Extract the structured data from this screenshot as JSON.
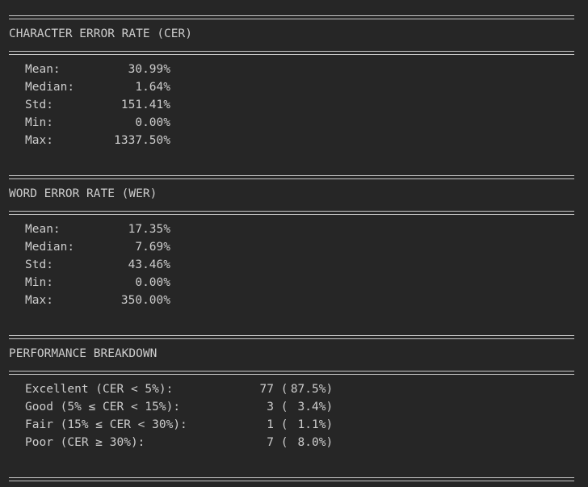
{
  "cer": {
    "title": "CHARACTER ERROR RATE (CER)",
    "stats": [
      {
        "label": "Mean:",
        "value": "30.99%"
      },
      {
        "label": "Median:",
        "value": "1.64%"
      },
      {
        "label": "Std:",
        "value": "151.41%"
      },
      {
        "label": "Min:",
        "value": "0.00%"
      },
      {
        "label": "Max:",
        "value": "1337.50%"
      }
    ]
  },
  "wer": {
    "title": "WORD ERROR RATE (WER)",
    "stats": [
      {
        "label": "Mean:",
        "value": "17.35%"
      },
      {
        "label": "Median:",
        "value": "7.69%"
      },
      {
        "label": "Std:",
        "value": "43.46%"
      },
      {
        "label": "Min:",
        "value": "0.00%"
      },
      {
        "label": "Max:",
        "value": "350.00%"
      }
    ]
  },
  "performance": {
    "title": "PERFORMANCE BREAKDOWN",
    "rows": [
      {
        "label": "Excellent (CER < 5%):",
        "count": "77",
        "pct": "87.5%"
      },
      {
        "label": "Good (5% ≤ CER < 15%):",
        "count": "3",
        "pct": "3.4%"
      },
      {
        "label": "Fair (15% ≤ CER < 30%):",
        "count": "1",
        "pct": "1.1%"
      },
      {
        "label": "Poor (CER ≥ 30%):",
        "count": "7",
        "pct": "8.0%"
      }
    ]
  },
  "punct": {
    "open": " (",
    "close": ")"
  }
}
